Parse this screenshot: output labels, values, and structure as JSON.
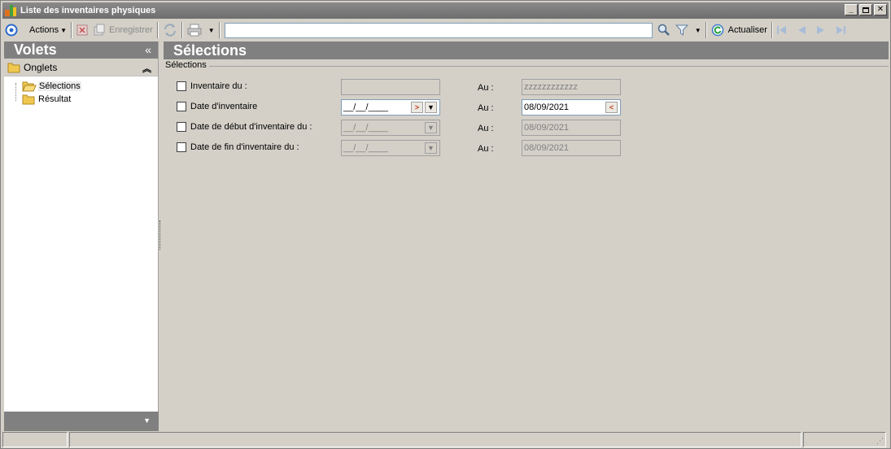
{
  "window": {
    "title": "Liste des inventaires physiques"
  },
  "toolbar": {
    "actions_label": "Actions",
    "save_label": "Enregistrer",
    "refresh_label": "Actualiser",
    "search_value": ""
  },
  "left_pane": {
    "header": "Volets",
    "collapse_glyph": "«",
    "tabs_header": "Onglets",
    "items": [
      {
        "label": "Sélections"
      },
      {
        "label": "Résultat"
      }
    ]
  },
  "main": {
    "header": "Sélections",
    "group_label": "Sélections",
    "rows": [
      {
        "label": "Inventaire du :",
        "from": "",
        "to_label": "Au :",
        "to": "zzzzzzzzzzzz"
      },
      {
        "label": "Date d'inventaire",
        "from": "__/__/____",
        "to_label": "Au :",
        "to": "08/09/2021"
      },
      {
        "label": "Date de début d'inventaire du :",
        "from": "__/__/____",
        "to_label": "Au :",
        "to": "08/09/2021"
      },
      {
        "label": "Date de fin d'inventaire du :",
        "from": "__/__/____",
        "to_label": "Au :",
        "to": "08/09/2021"
      }
    ]
  },
  "colors": {
    "pane_header": "#808080",
    "window_bg": "#d4d0c8",
    "field_border": "#7f9db9"
  }
}
